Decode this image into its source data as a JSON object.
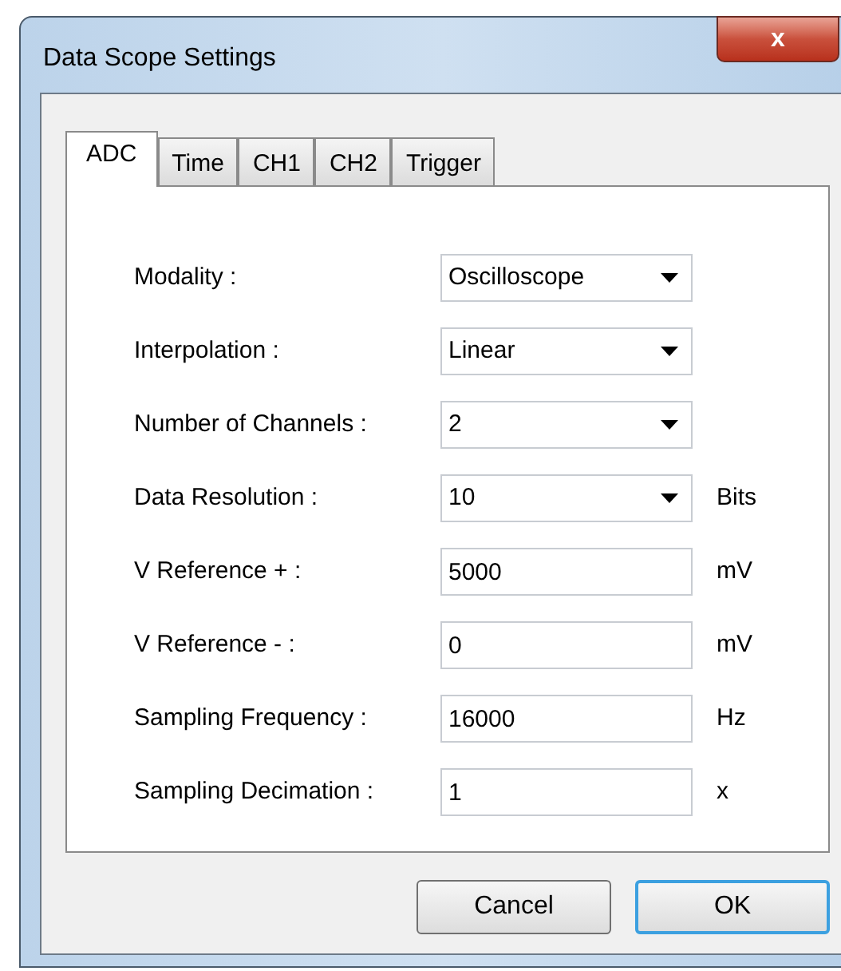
{
  "window": {
    "title": "Data Scope Settings",
    "close_label": "x"
  },
  "tabs": [
    {
      "label": "ADC",
      "selected": true
    },
    {
      "label": "Time",
      "selected": false
    },
    {
      "label": "CH1",
      "selected": false
    },
    {
      "label": "CH2",
      "selected": false
    },
    {
      "label": "Trigger",
      "selected": false
    }
  ],
  "fields": [
    {
      "label": "Modality :",
      "kind": "dropdown",
      "value": "Oscilloscope"
    },
    {
      "label": "Interpolation :",
      "kind": "dropdown",
      "value": "Linear"
    },
    {
      "label": "Number of Channels :",
      "kind": "dropdown",
      "value": "2"
    },
    {
      "label": "Data Resolution :",
      "kind": "dropdown",
      "value": "10",
      "unit": "Bits"
    },
    {
      "label": "V Reference + :",
      "kind": "text",
      "value": "5000",
      "unit": "mV"
    },
    {
      "label": "V Reference - :",
      "kind": "text",
      "value": "0",
      "unit": "mV"
    },
    {
      "label": "Sampling Frequency :",
      "kind": "text",
      "value": "16000",
      "unit": "Hz"
    },
    {
      "label": "Sampling Decimation :",
      "kind": "text",
      "value": "1",
      "unit": "x"
    }
  ],
  "buttons": [
    {
      "label": "Cancel",
      "default": false
    },
    {
      "label": "OK",
      "default": true
    }
  ]
}
